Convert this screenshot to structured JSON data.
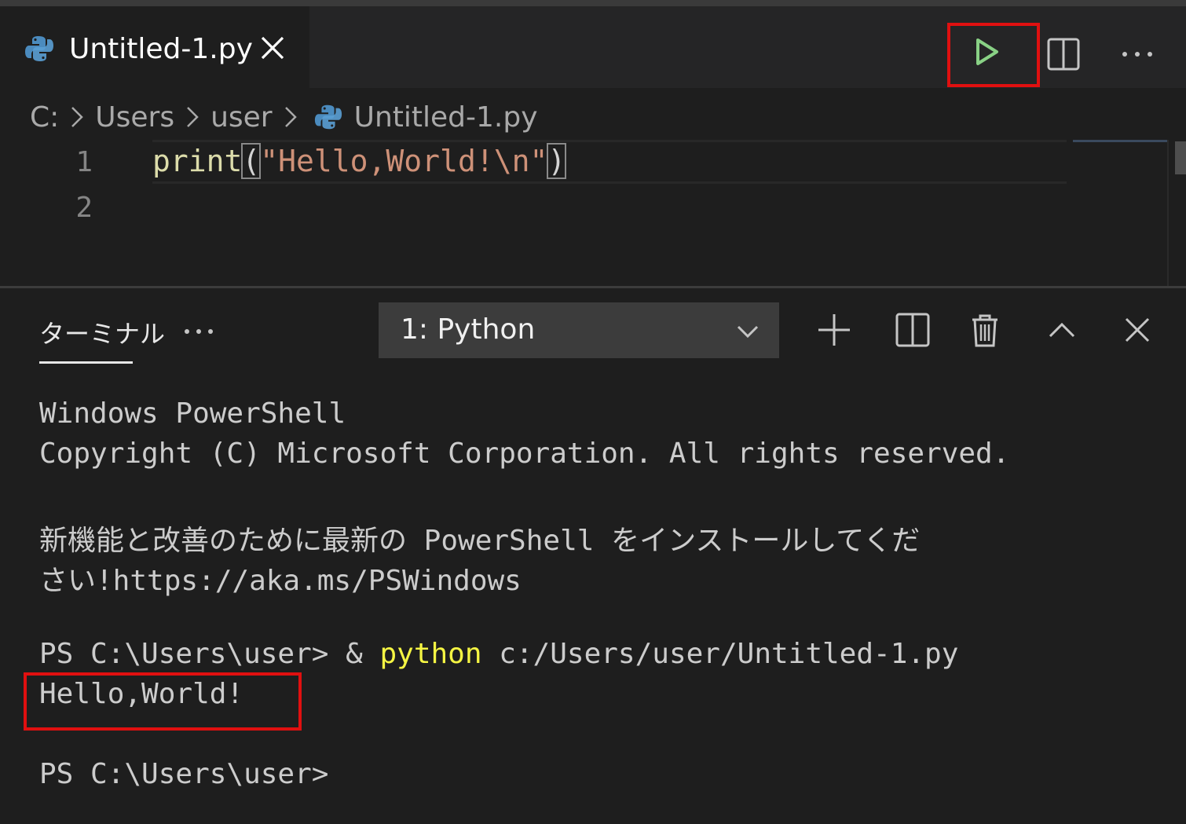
{
  "tab": {
    "title": "Untitled-1.py"
  },
  "breadcrumb": {
    "drive": "C:",
    "folder1": "Users",
    "folder2": "user",
    "file": "Untitled-1.py"
  },
  "editor": {
    "line_numbers": [
      "1",
      "2"
    ],
    "code": {
      "fn": "print",
      "open": "(",
      "str": "\"Hello,World!\\n\"",
      "close": ")"
    }
  },
  "panel": {
    "tab_label": "ターミナル",
    "terminal_select": "1: Python"
  },
  "terminal": {
    "l1": "Windows PowerShell",
    "l2": "Copyright (C) Microsoft Corporation. All rights reserved.",
    "l3": "新機能と改善のために最新の PowerShell をインストールしてくだ",
    "l4": "さい!https://aka.ms/PSWindows",
    "l5_prompt": "PS C:\\Users\\user> & ",
    "l5_cmd": "python",
    "l5_arg": " c:/Users/user/Untitled-1.py",
    "l6": "Hello,World!",
    "l7": "PS C:\\Users\\user>"
  },
  "colors": {
    "accent_run": "#89d185",
    "highlight": "#e01010",
    "yellow": "#f5f543"
  },
  "icons": [
    "python-file-icon",
    "close-icon",
    "run-icon",
    "split-editor-icon",
    "more-icon",
    "chevron-right-icon",
    "plus-icon",
    "split-terminal-icon",
    "trash-icon",
    "chevron-up-icon",
    "chevron-down-icon"
  ]
}
